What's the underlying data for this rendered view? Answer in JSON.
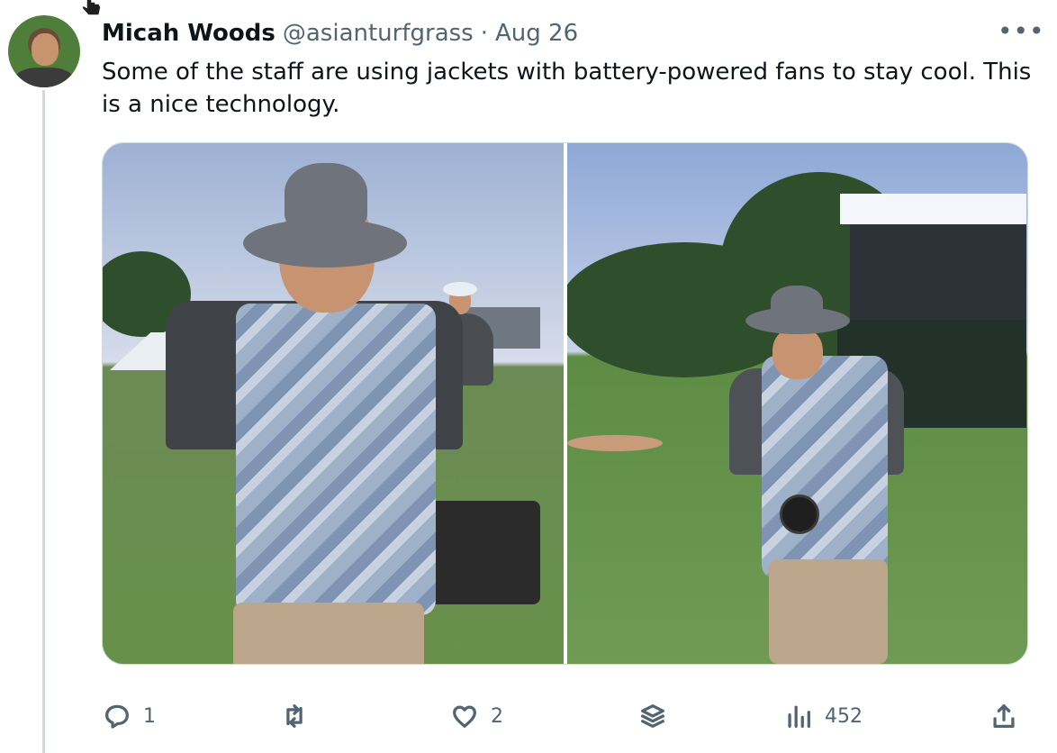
{
  "post": {
    "author_name": "Micah Woods",
    "author_handle": "@asianturfgrass",
    "separator": "·",
    "date": "Aug 26",
    "more_icon": "•••",
    "text": "Some of the staff are using jackets with battery-powered fans to stay cool. This is a nice technology."
  },
  "media": {
    "images": [
      {
        "name": "worker-front-vest-photo"
      },
      {
        "name": "worker-back-vest-photo"
      }
    ]
  },
  "actions": {
    "reply_count": "1",
    "retweet_count": "",
    "like_count": "2",
    "views_count": "452"
  },
  "icons": {
    "reply": "reply-icon",
    "retweet": "retweet-icon",
    "like": "heart-icon",
    "layers": "layers-icon",
    "views": "views-icon",
    "share": "share-icon"
  }
}
